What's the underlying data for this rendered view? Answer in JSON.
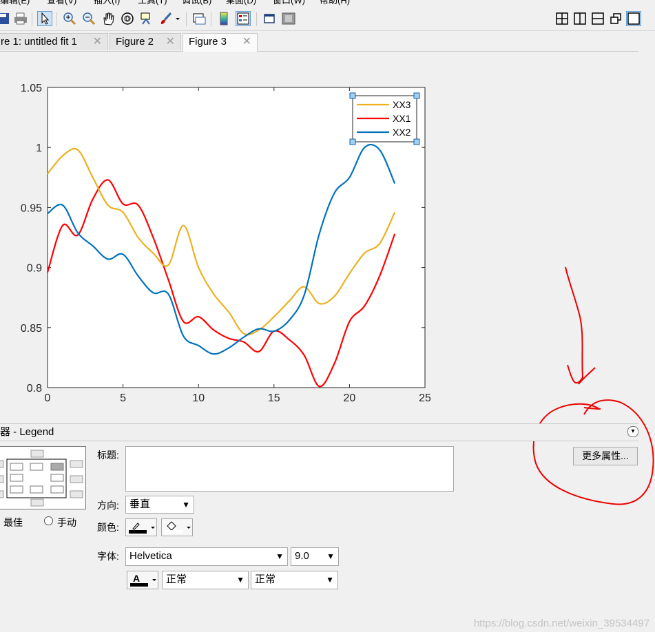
{
  "menu": {
    "items": [
      "编辑(E)",
      "查看(V)",
      "插入(I)",
      "工具(T)",
      "调试(B)",
      "桌面(D)",
      "窗口(W)",
      "帮助(H)"
    ]
  },
  "toolbar": {
    "icons": [
      "save-icon",
      "print-icon",
      "pointer-icon",
      "zoom-in-icon",
      "zoom-out-icon",
      "pan-icon",
      "rotate-3d-icon",
      "data-cursor-icon",
      "brush-icon",
      "link-plot-icon",
      "colorbar-icon",
      "legend-icon",
      "hide-plot-tools-icon",
      "show-plot-tools-icon",
      "tile-icon",
      "left-right-icon",
      "top-bottom-icon",
      "float-icon",
      "maximize-icon"
    ]
  },
  "tabs": [
    {
      "label": "re 1: untitled fit 1"
    },
    {
      "label": "Figure 2"
    },
    {
      "label": "Figure 3"
    }
  ],
  "chart_data": {
    "type": "line",
    "title": "",
    "xlabel": "",
    "ylabel": "",
    "xlim": [
      0,
      25
    ],
    "ylim": [
      0.8,
      1.05
    ],
    "xticks": [
      "0",
      "5",
      "10",
      "15",
      "20",
      "25"
    ],
    "yticks": [
      "0.8",
      "0.85",
      "0.9",
      "0.95",
      "1",
      "1.05"
    ],
    "grid": false,
    "legend_position": "top-right",
    "series": [
      {
        "name": "XX3",
        "color": "#edb120",
        "x": [
          0,
          1,
          2,
          3,
          4,
          5,
          6,
          7,
          8,
          9,
          10,
          11,
          12,
          13,
          14,
          15,
          16,
          17,
          18,
          19,
          20,
          21,
          22,
          23
        ],
        "y": [
          0.978,
          0.993,
          0.998,
          0.975,
          0.952,
          0.946,
          0.925,
          0.912,
          0.902,
          0.935,
          0.9,
          0.878,
          0.863,
          0.845,
          0.848,
          0.859,
          0.872,
          0.884,
          0.87,
          0.876,
          0.895,
          0.912,
          0.92,
          0.946
        ]
      },
      {
        "name": "XX1",
        "color": "#ff0000",
        "x": [
          0,
          1,
          2,
          3,
          4,
          5,
          6,
          7,
          8,
          9,
          10,
          11,
          12,
          13,
          14,
          15,
          16,
          17,
          18,
          19,
          20,
          21,
          22,
          23
        ],
        "y": [
          0.896,
          0.935,
          0.927,
          0.957,
          0.973,
          0.953,
          0.952,
          0.925,
          0.89,
          0.855,
          0.859,
          0.848,
          0.841,
          0.838,
          0.83,
          0.847,
          0.84,
          0.827,
          0.801,
          0.82,
          0.855,
          0.868,
          0.893,
          0.928
        ]
      },
      {
        "name": "XX2",
        "color": "#0072bd",
        "x": [
          0,
          1,
          2,
          3,
          4,
          5,
          6,
          7,
          8,
          9,
          10,
          11,
          12,
          13,
          14,
          15,
          16,
          17,
          18,
          19,
          20,
          21,
          22,
          23
        ],
        "y": [
          0.945,
          0.952,
          0.929,
          0.918,
          0.907,
          0.911,
          0.893,
          0.879,
          0.878,
          0.843,
          0.835,
          0.828,
          0.833,
          0.842,
          0.849,
          0.847,
          0.856,
          0.877,
          0.928,
          0.962,
          0.975,
          1.0,
          0.998,
          0.97
        ]
      }
    ]
  },
  "inspector": {
    "title": "器 - Legend",
    "title_label": "标题:",
    "title_value": "",
    "orientation_label": "方向:",
    "orientation_value": "垂直",
    "color_label": "颜色:",
    "location_best": "最佳",
    "location_manual": "手动",
    "font_label": "字体:",
    "font_value": "Helvetica",
    "font_size": "9.0",
    "font_weight": "正常",
    "font_angle": "正常",
    "more_button": "更多属性..."
  },
  "watermark": "https://blog.csdn.net/weixin_39534497"
}
